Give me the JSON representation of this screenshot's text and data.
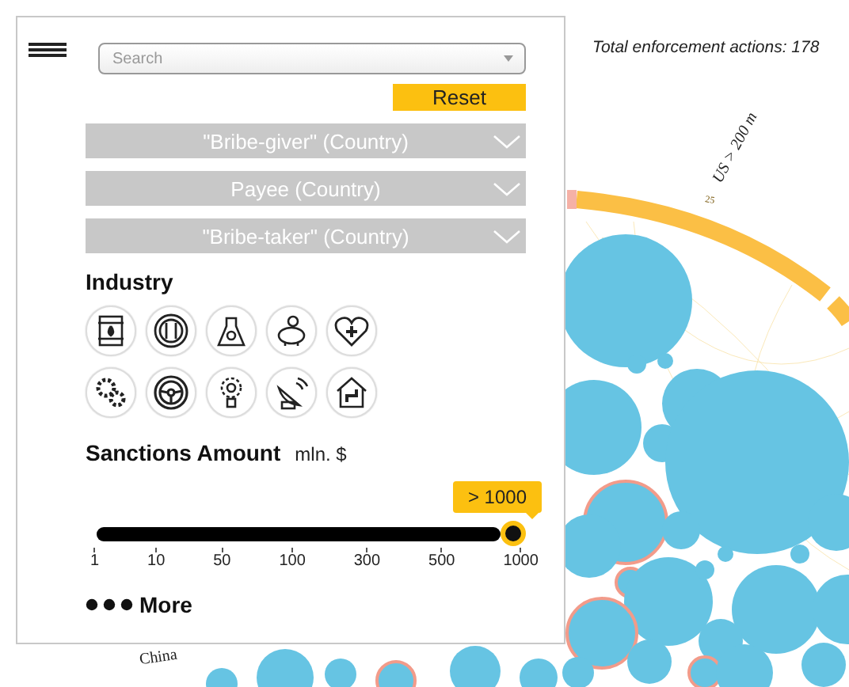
{
  "filter_panel": {
    "search": {
      "placeholder": "Search"
    },
    "reset_button": "Reset",
    "dropdowns": [
      {
        "label": "\"Bribe-giver\" (Country)"
      },
      {
        "label": "Payee (Country)"
      },
      {
        "label": "\"Bribe-taker\" (Country)"
      }
    ],
    "industry": {
      "title": "Industry"
    },
    "sanctions": {
      "title": "Sanctions Amount",
      "unit": "mln. $",
      "value_tooltip": "> 1000",
      "level": 1,
      "ticks": [
        "1",
        "10",
        "50",
        "100",
        "300",
        "500",
        "1000"
      ]
    },
    "more": "More"
  },
  "visualization": {
    "total": "Total enforcement actions: 178",
    "arc_label": "US > 200 m",
    "arc_value": "25",
    "country_label": "China"
  }
}
